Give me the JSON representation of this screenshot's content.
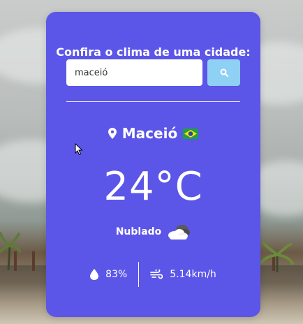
{
  "app": {
    "title": "Confira o clima de uma cidade:"
  },
  "search": {
    "value": "maceió",
    "placeholder": "",
    "button_icon": "search-icon"
  },
  "weather": {
    "city": "Maceió",
    "country_flag": "brazil-flag",
    "temperature": "24°C",
    "condition": "Nublado",
    "condition_icon": "cloudy-icon",
    "humidity": "83%",
    "humidity_icon": "water-drop-icon",
    "wind": "5.14km/h",
    "wind_icon": "wind-icon"
  },
  "colors": {
    "card": "#5b55e8",
    "button": "#8fd0f5",
    "text": "#ffffff"
  }
}
